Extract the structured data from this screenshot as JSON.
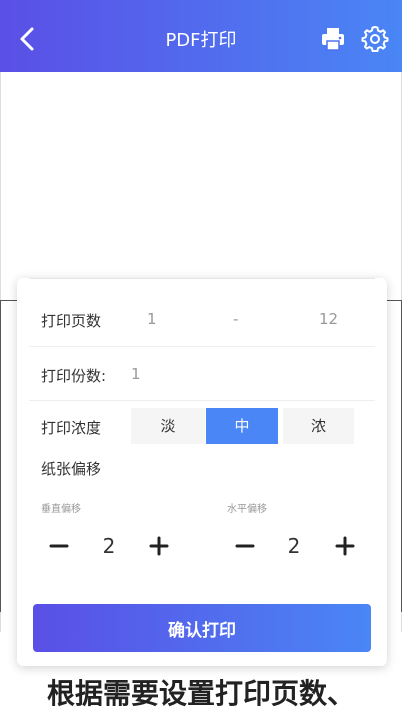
{
  "header": {
    "title": "PDF打印",
    "icons": {
      "back": "back-arrow-icon",
      "print": "printer-icon",
      "settings": "gear-icon"
    }
  },
  "pages": {
    "label": "打印页数",
    "from": "1",
    "separator": "-",
    "to": "12"
  },
  "copies": {
    "label": "打印份数:",
    "value": "1"
  },
  "density": {
    "label": "打印浓度",
    "options": [
      "淡",
      "中",
      "浓"
    ],
    "selected": "中"
  },
  "offset": {
    "label": "纸张偏移",
    "vertical": {
      "label": "垂直偏移",
      "value": "2"
    },
    "horizontal": {
      "label": "水平偏移",
      "value": "2"
    }
  },
  "confirm_label": "确认打印",
  "caption": "根据需要设置打印页数、",
  "colors": {
    "accent_start": "#5a4fe6",
    "accent_end": "#4a86f5"
  }
}
